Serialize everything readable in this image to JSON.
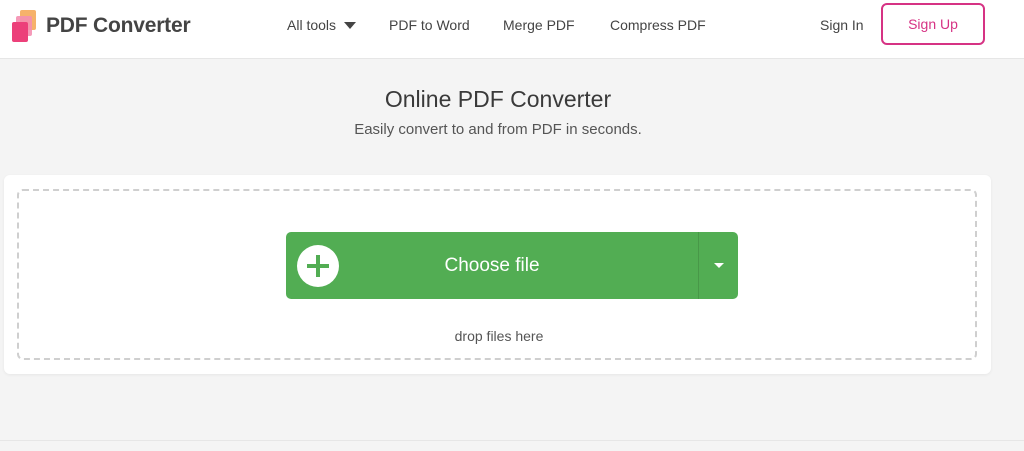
{
  "header": {
    "logo_text": "PDF Converter",
    "nav": {
      "all_tools": "All tools",
      "pdf_to_word": "PDF to Word",
      "merge_pdf": "Merge PDF",
      "compress_pdf": "Compress PDF",
      "sign_in": "Sign In",
      "sign_up": "Sign Up"
    }
  },
  "main": {
    "title": "Online PDF Converter",
    "subtitle": "Easily convert to and from PDF in seconds.",
    "upload": {
      "choose_label": "Choose file",
      "drop_hint": "drop files here"
    }
  },
  "icons": {
    "logo": "logo-icon",
    "all_tools_caret": "caret-down-icon",
    "choose_plus": "plus-circle-icon",
    "dropdown_caret": "caret-down-icon"
  },
  "colors": {
    "accent_green": "#52ad53",
    "accent_pink": "#d63384",
    "background": "#f4f4f4"
  }
}
